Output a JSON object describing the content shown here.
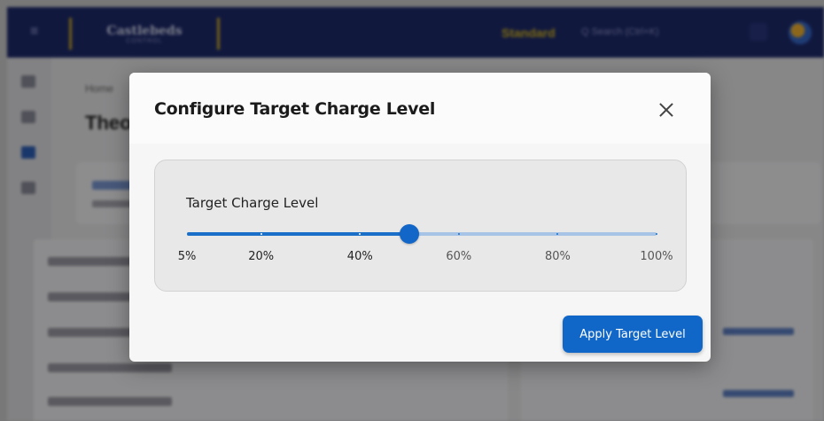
{
  "background": {
    "logo_line1": "Castlebeds",
    "logo_line2": "CONTROL",
    "plan": "Standard",
    "search": "Q  Search (Ctrl+K)",
    "breadcrumb": "Home",
    "page_title": "Theo"
  },
  "modal": {
    "title": "Configure Target Charge Level",
    "slider": {
      "label": "Target Charge Level",
      "min": 5,
      "max": 100,
      "value": 50,
      "ticks": [
        {
          "value": 5,
          "label": "5%"
        },
        {
          "value": 20,
          "label": "20%"
        },
        {
          "value": 40,
          "label": "40%"
        },
        {
          "value": 60,
          "label": "60%"
        },
        {
          "value": 80,
          "label": "80%"
        },
        {
          "value": 100,
          "label": "100%"
        }
      ]
    },
    "apply_label": "Apply Target Level"
  },
  "colors": {
    "accent": "#1167c7",
    "track_inactive": "#a7c4e6",
    "header_bar": "#1d2a6c"
  },
  "icons": {
    "close": "close-icon",
    "menu": "hamburger-icon"
  }
}
